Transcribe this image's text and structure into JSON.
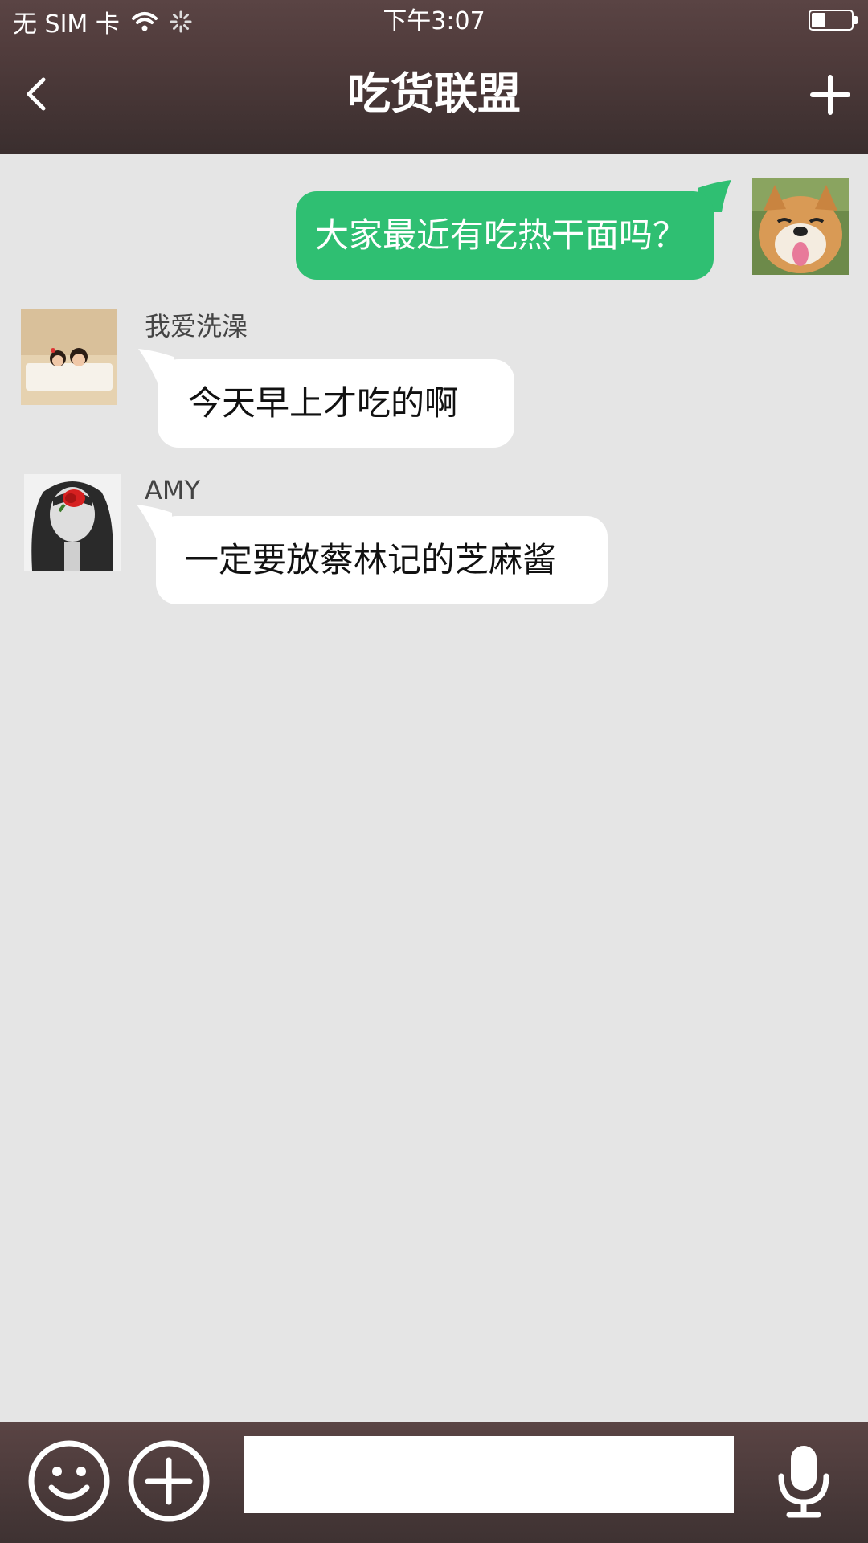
{
  "status_bar": {
    "carrier": "无 SIM 卡",
    "time": "下午3:07",
    "battery_level": 0.35
  },
  "header": {
    "title": "吃货联盟"
  },
  "messages": [
    {
      "direction": "outgoing",
      "sender": "",
      "text": "大家最近有吃热干面吗？",
      "avatar": "shiba-dog-avatar"
    },
    {
      "direction": "incoming",
      "sender": "我爱洗澡",
      "text": "今天早上才吃的啊",
      "avatar": "bathtub-kids-avatar"
    },
    {
      "direction": "incoming",
      "sender": "AMY",
      "text": "一定要放蔡林记的芝麻酱",
      "avatar": "girl-rose-avatar"
    }
  ],
  "input_bar": {
    "message_value": "",
    "icons": [
      "emoji-icon",
      "plus-circle-icon",
      "microphone-icon"
    ]
  },
  "colors": {
    "bar_dark": "#523d3d",
    "chat_bg": "#e5e5e5",
    "outgoing_bubble": "#2fbf72",
    "incoming_bubble": "#ffffff"
  }
}
